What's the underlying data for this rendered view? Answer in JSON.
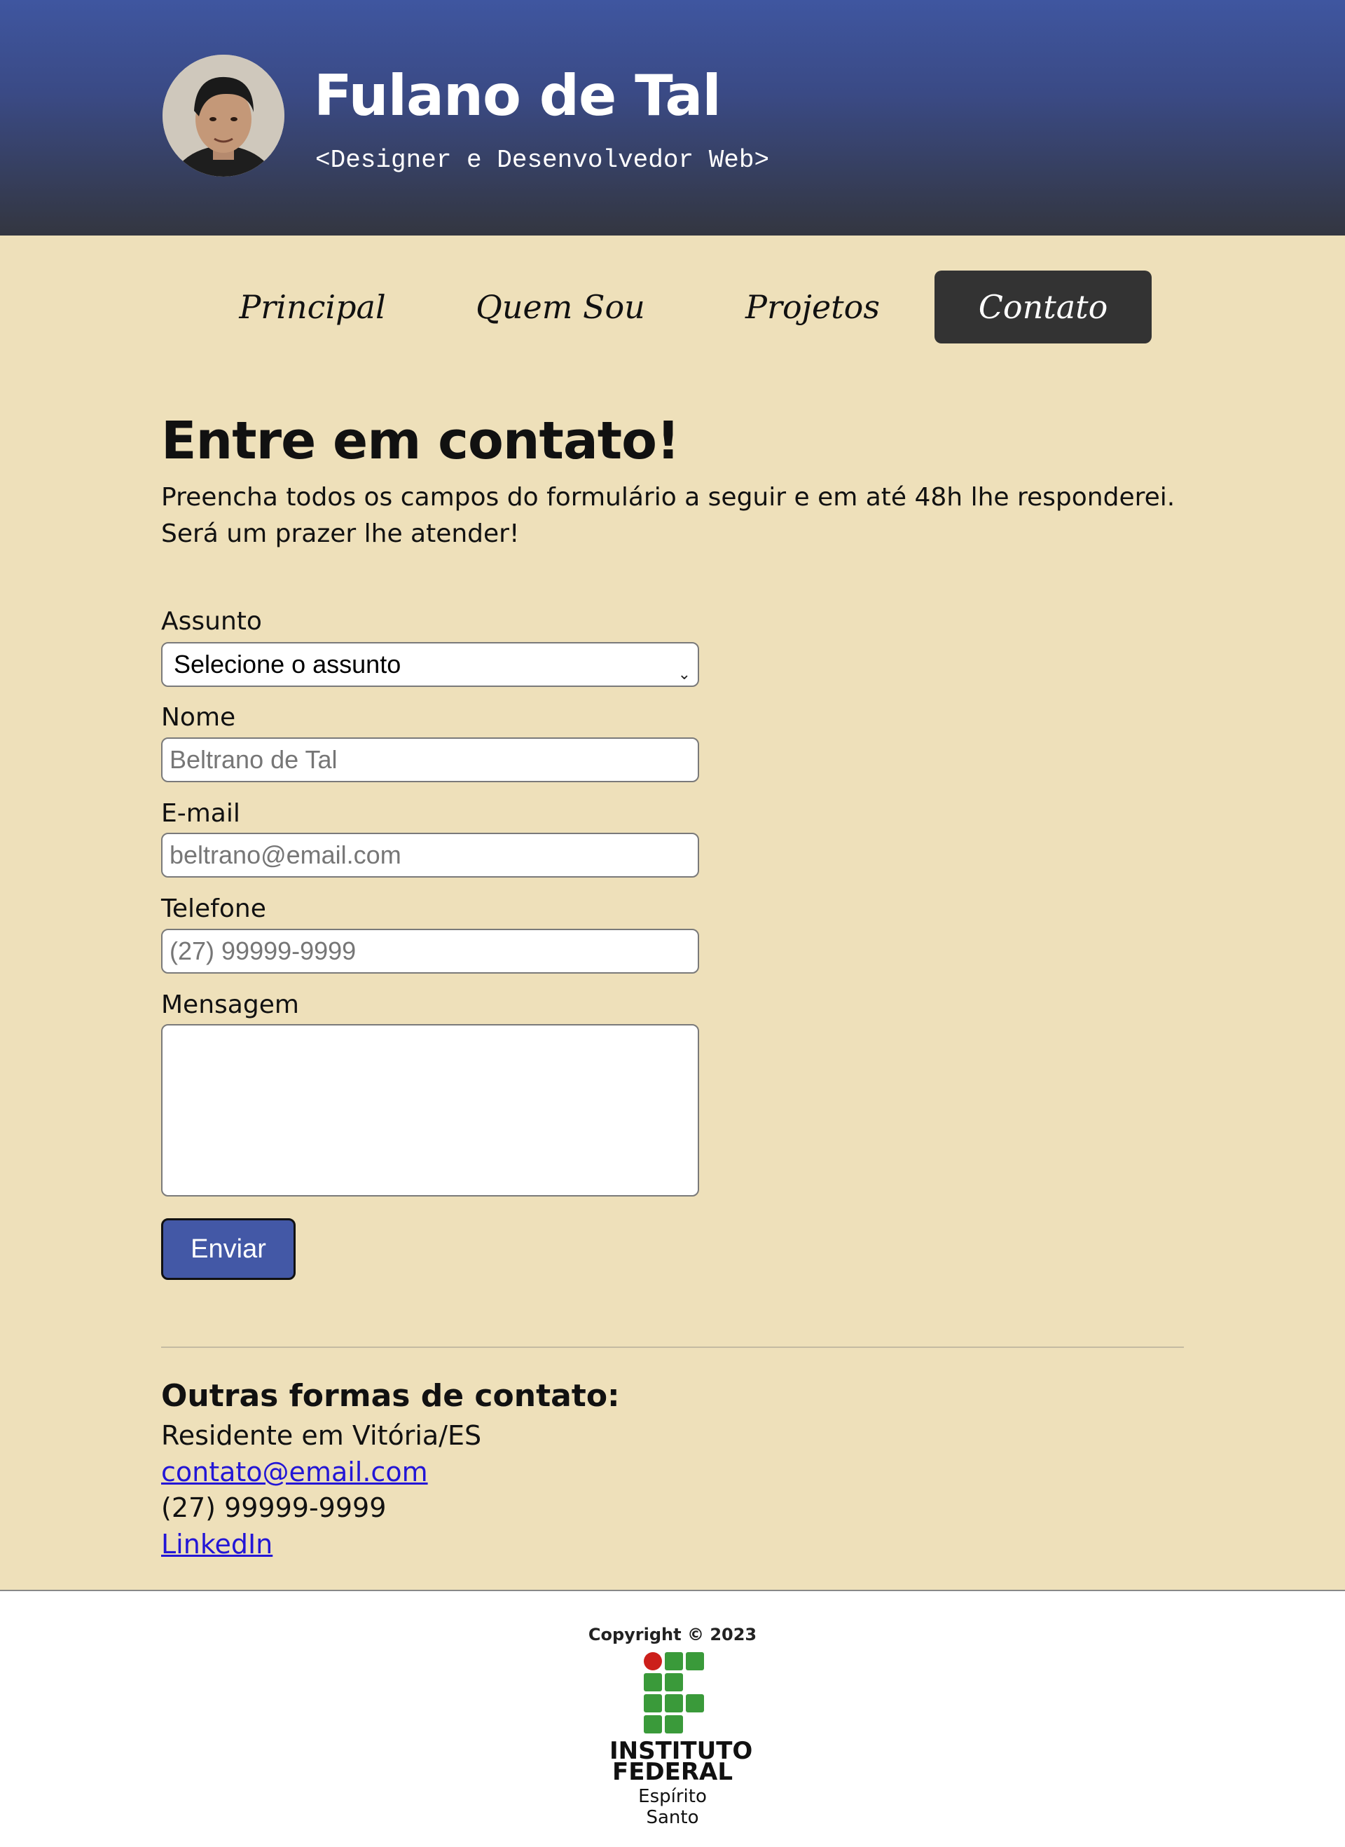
{
  "header": {
    "title": "Fulano de Tal",
    "subtitle": "<Designer e Desenvolvedor Web>"
  },
  "nav": {
    "items": [
      {
        "label": "Principal"
      },
      {
        "label": "Quem Sou"
      },
      {
        "label": "Projetos"
      },
      {
        "label": "Contato",
        "active": true
      }
    ]
  },
  "main": {
    "title": "Entre em contato!",
    "intro": "Preencha todos os campos do formulário a seguir e em até 48h lhe responderei. Será um prazer lhe atender!"
  },
  "form": {
    "subject_label": "Assunto",
    "subject_value": "Selecione o assunto",
    "name_label": "Nome",
    "name_placeholder": "Beltrano de Tal",
    "email_label": "E-mail",
    "email_placeholder": "beltrano@email.com",
    "phone_label": "Telefone",
    "phone_placeholder": "(27) 99999-9999",
    "message_label": "Mensagem",
    "message_value": "",
    "submit_label": "Enviar"
  },
  "other_contacts": {
    "title": "Outras formas de contato:",
    "location": "Residente em Vitória/ES",
    "email": "contato@email.com",
    "phone": "(27) 99999-9999",
    "linkedin": "LinkedIn"
  },
  "footer": {
    "copyright": "Copyright © 2023",
    "logo_line1": "INSTITUTO",
    "logo_line2": "FEDERAL",
    "logo_line3": "Espírito Santo"
  },
  "colors": {
    "header_top": "#3f56a0",
    "header_bottom": "#333640",
    "background": "#eee0ba",
    "active_nav": "#333333",
    "button": "#4358a6",
    "link": "#2316d6",
    "logo_green": "#3a9a3a",
    "logo_red": "#cc1f1a"
  }
}
